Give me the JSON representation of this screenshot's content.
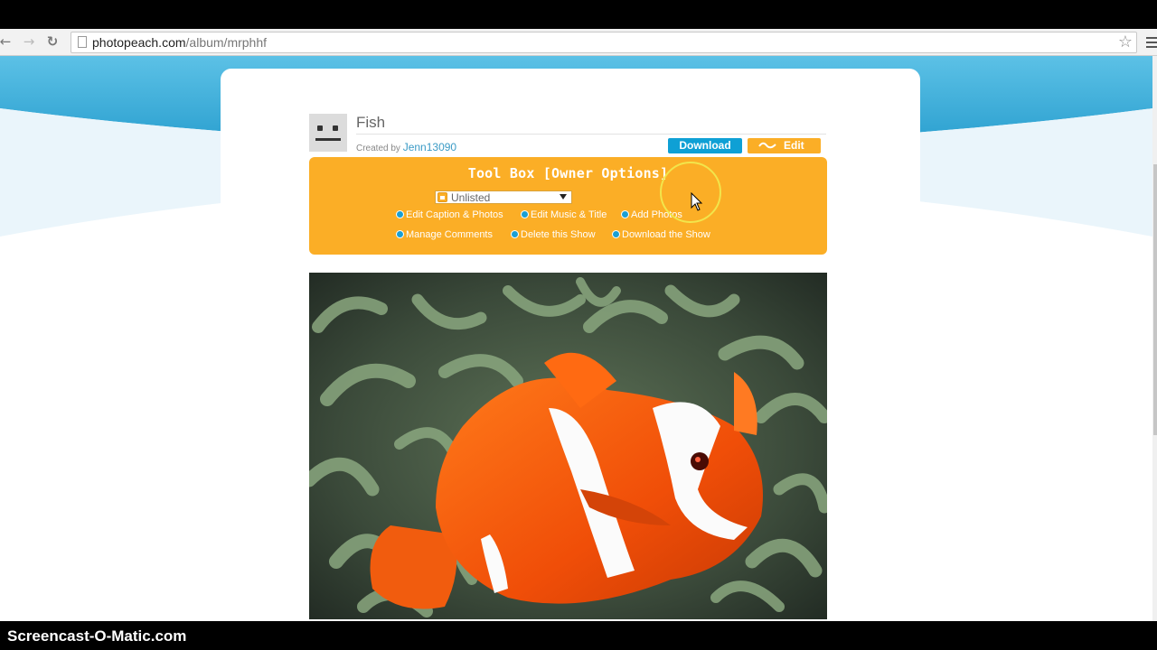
{
  "browser": {
    "url_domain": "photopeach.com",
    "url_path": "/album/mrphhf",
    "icons": {
      "back": "back-arrow-icon",
      "forward": "forward-arrow-icon",
      "reload": "reload-icon",
      "bookmark": "star-icon",
      "menu": "hamburger-menu-icon"
    }
  },
  "show": {
    "title": "Fish",
    "created_by_label": "Created by",
    "creator": "Jenn13090",
    "download_label": "Download",
    "edit_label": "Edit"
  },
  "toolbox": {
    "title": "Tool Box [Owner Options]",
    "visibility_selected": "Unlisted",
    "links": {
      "edit_caption": "Edit Caption & Photos",
      "edit_music": "Edit Music & Title",
      "add_photos": "Add Photos",
      "manage_comments": "Manage Comments",
      "delete_show": "Delete this Show",
      "download_show": "Download the Show"
    }
  },
  "photo": {
    "subject": "clownfish-photo"
  },
  "colors": {
    "accent_orange": "#fbae26",
    "download_blue": "#0fa0d5",
    "link_blue": "#3b9bc6",
    "sky_blue": "#3aaad6"
  },
  "watermark": "Screencast-O-Matic.com"
}
